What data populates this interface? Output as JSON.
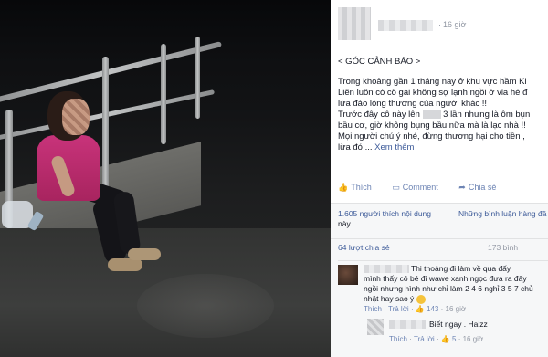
{
  "post": {
    "time": "16 giờ",
    "heading": "< GÓC CẢNH BÁO >",
    "lines": [
      "Trong khoảng gần 1 tháng nay ở khu vực hầm Ki",
      "Liên luôn có cô gái không sợ lạnh ngồi ở vỉa hè đ",
      "lừa đảo lòng thương của người khác !!",
      "Trước đây cô này lên",
      "3 lần nhưng là ôm bụn",
      "bầu cơ, giờ không bụng bầu nữa mà là lạc nhà !!",
      "Mọi người chú ý nhé, đừng thương hại cho tiền ,",
      "lừa đó ..."
    ],
    "see_more": "Xem thêm"
  },
  "actions": {
    "like": "Thích",
    "comment": "Comment",
    "share": "Chia sẻ"
  },
  "feedback": {
    "likes_line1": "1.605 người thích nội dung",
    "likes_line2": "này.",
    "chronological": "Những bình luận hàng đầ",
    "shares": "64 lượt chia sẻ",
    "comments_count": "173 bình"
  },
  "comment": {
    "lines": [
      "Thi thoảng đi làm về qua đấy",
      "mình thấy cô bé đi wawe xanh ngọc đưa ra đấy",
      "ngồi nhưng hình như chỉ làm 2 4 6 nghỉ 3 5 7 chủ",
      "nhật hay sao ý"
    ],
    "like": "Thích",
    "reply": "Trả lời",
    "like_count": "143",
    "time": "16 giờ"
  },
  "reply": {
    "text": "Biết ngay . Haizz",
    "like": "Thích",
    "reply": "Trả lời",
    "like_count": "5",
    "time": "16 giờ"
  },
  "icons": {
    "globe": "globe-icon",
    "like": "thumbs-up-icon",
    "comment": "speech-bubble-icon",
    "share": "share-arrow-icon"
  },
  "colors": {
    "link": "#3b5998",
    "muted": "#9197a3",
    "shirt": "#c8337a"
  }
}
